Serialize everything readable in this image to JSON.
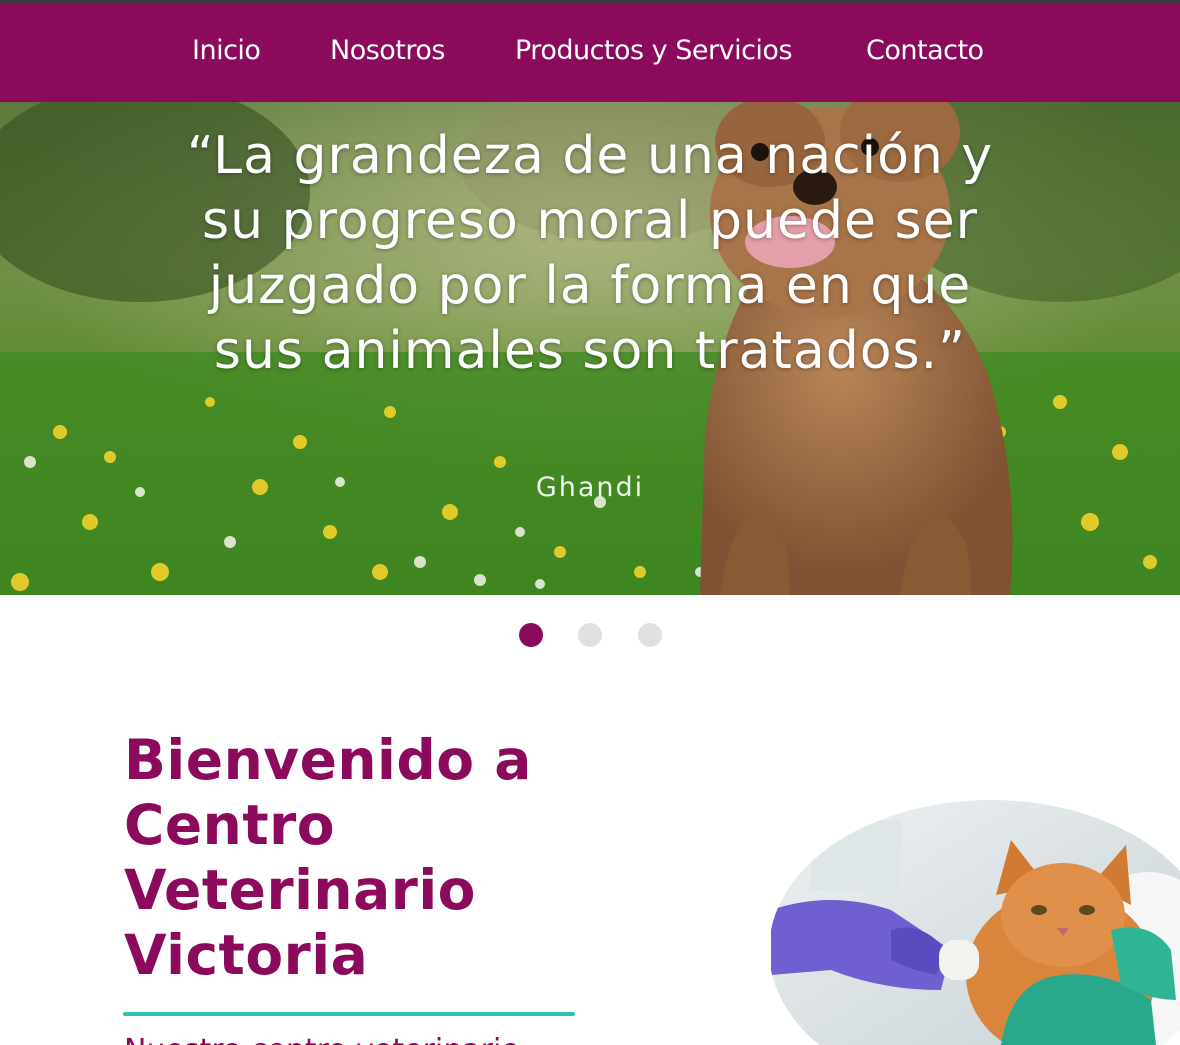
{
  "nav": {
    "items": [
      {
        "label": "Inicio"
      },
      {
        "label": "Nosotros"
      },
      {
        "label": "Productos y Servicios"
      },
      {
        "label": "Contacto"
      }
    ]
  },
  "hero": {
    "quote": "“La grandeza de una nación y su progreso moral puede ser juzgado por la forma en que sus animales son tratados.”",
    "author": "Ghandi",
    "slide_count": 3,
    "active_slide": 1
  },
  "welcome": {
    "title": "Bienvenido a Centro Veterinario Victoria",
    "intro_partial": "Nuestro centro veterinario"
  },
  "colors": {
    "brand": "#8c0a5c",
    "accent": "#2ec4b0",
    "dot_inactive": "#e0e0e0"
  }
}
